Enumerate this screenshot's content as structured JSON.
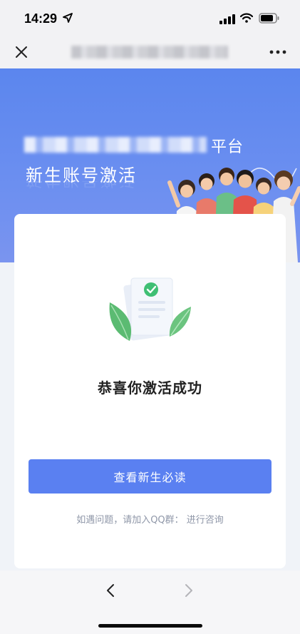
{
  "status_bar": {
    "time": "14:29",
    "icons": [
      "location-arrow-icon",
      "signal-icon",
      "wifi-icon",
      "battery-icon"
    ]
  },
  "nav_bar": {
    "close_icon": "close-icon",
    "more_icon": "more-icon"
  },
  "banner": {
    "platform_suffix": "平台",
    "title": "新生账号激活",
    "colors": {
      "gradient_top": "#5b86ee",
      "gradient_bottom": "#7a94ef"
    }
  },
  "card": {
    "success_text": "恭喜你激活成功",
    "primary_button_label": "查看新生必读",
    "help_prefix": "如遇问题，请加入QQ群：",
    "help_link": "进行咨询"
  },
  "bottom_bar": {
    "back_icon": "back-icon",
    "forward_icon": "forward-icon"
  },
  "colors": {
    "accent": "#5a80f1",
    "success_green": "#3fbf74",
    "help_text": "#8f97a8"
  }
}
